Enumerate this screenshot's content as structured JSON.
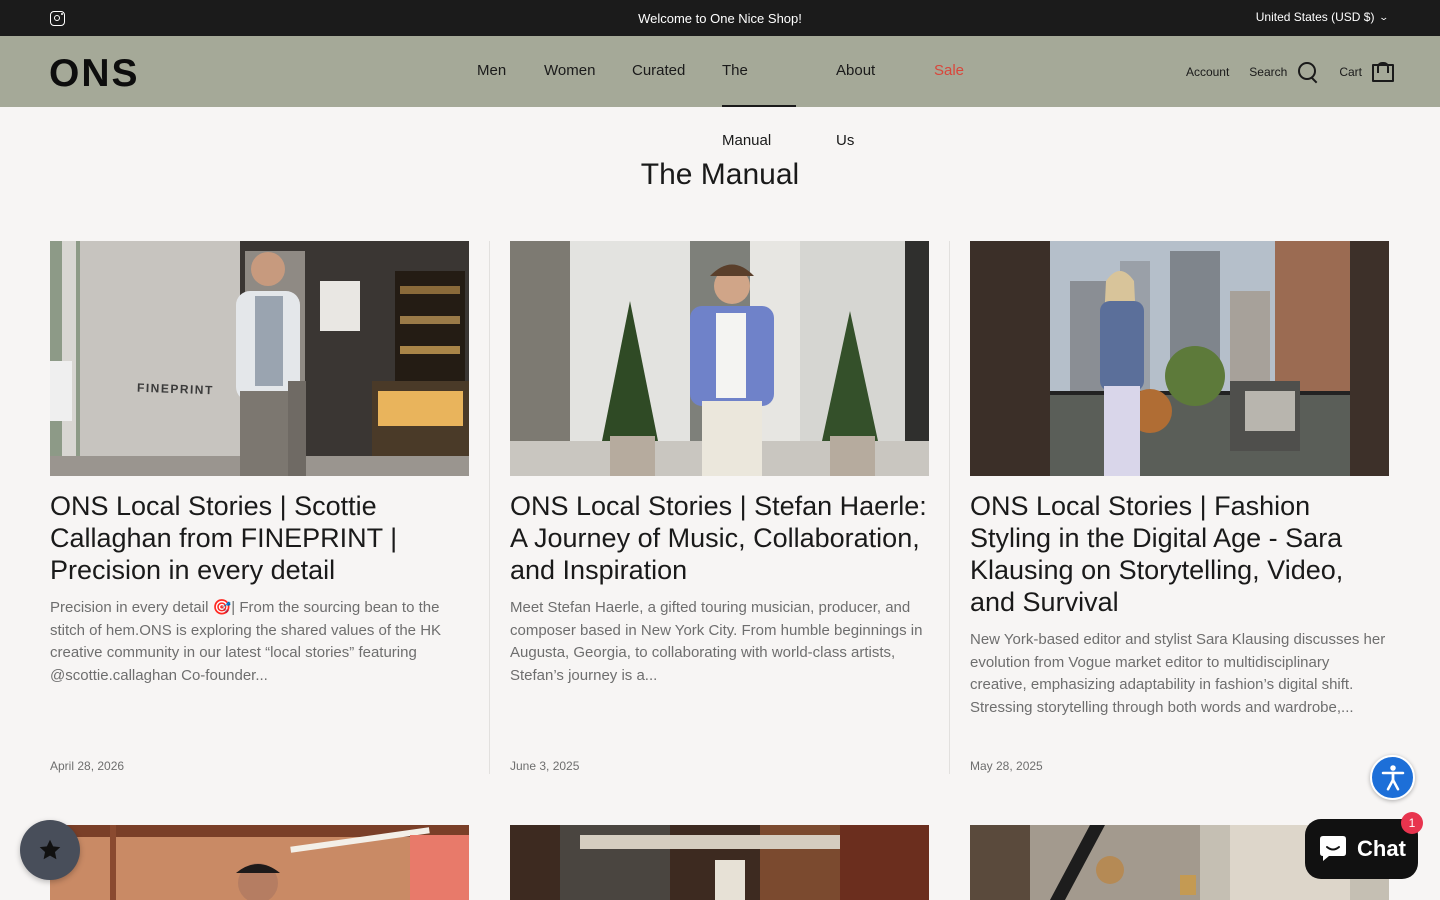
{
  "announcement": {
    "text": "Welcome to One Nice Shop!",
    "locale": "United States (USD $)"
  },
  "header": {
    "logo": "ONS",
    "nav": [
      {
        "label": "Men"
      },
      {
        "label": "Women"
      },
      {
        "label": "Curated"
      },
      {
        "label": "The Manual",
        "active": true
      },
      {
        "label": "About Us"
      },
      {
        "label": "Sale"
      }
    ],
    "account_label": "Account",
    "search_label": "Search",
    "cart_label": "Cart",
    "sale_color": "#d9463b",
    "header_bg": "#a5a998"
  },
  "page": {
    "title": "The Manual"
  },
  "articles": [
    {
      "title": "ONS Local Stories | Scottie Callaghan from FINEPRINT | Precision in every detail",
      "excerpt": "Precision in every detail 🎯| From the sourcing bean to the stitch of hem.ONS is exploring the shared values of the HK creative community in our latest “local stories” featuring @scottie.callaghan Co-founder...",
      "date": "April 28, 2026",
      "sign_text": "FINEPRINT"
    },
    {
      "title": "ONS Local Stories | Stefan Haerle: A Journey of Music, Collaboration, and Inspiration",
      "excerpt": "Meet Stefan Haerle, a gifted touring musician, producer, and composer based in New York City. From humble beginnings in Augusta, Georgia, to collaborating with world-class artists, Stefan’s journey is a...",
      "date": "June 3, 2025"
    },
    {
      "title": "ONS Local Stories | Fashion Styling in the Digital Age - Sara Klausing on Storytelling, Video, and Survival",
      "excerpt": "New York-based editor and stylist Sara Klausing discusses her evolution from Vogue market editor to multidisciplinary creative, emphasizing adaptability in fashion’s digital shift. Stressing storytelling through both words and wardrobe,...",
      "date": "May 28, 2025"
    }
  ],
  "widgets": {
    "chat_label": "Chat",
    "chat_badge": "1",
    "rewards_icon": "star-icon",
    "accessibility_icon": "accessibility-icon"
  }
}
